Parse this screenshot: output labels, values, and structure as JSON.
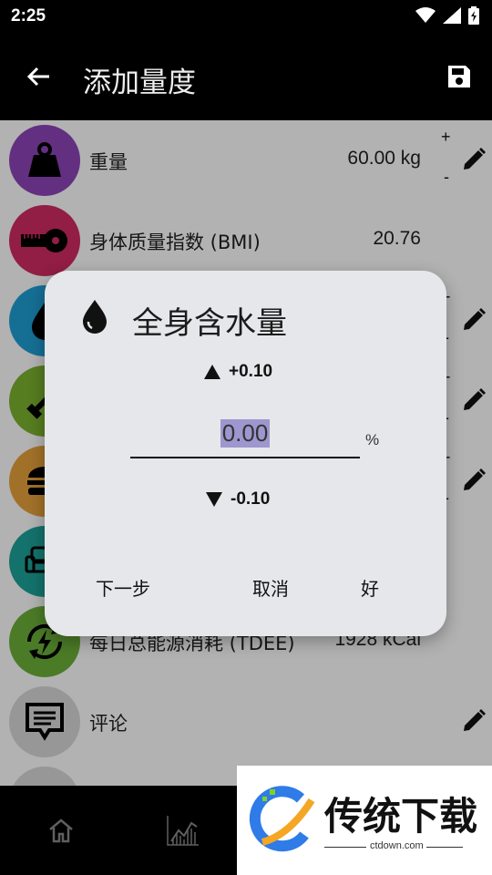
{
  "status": {
    "time": "2:25",
    "icons": [
      "wifi-icon",
      "signal-icon",
      "battery-charging-icon"
    ]
  },
  "appbar": {
    "title": "添加量度",
    "back_icon": "arrow-left-icon",
    "save_icon": "save-icon"
  },
  "rows": [
    {
      "label": "重量",
      "value": "60.00 kg",
      "color": "#8e44b8",
      "icon": "weight-icon",
      "adjust": true,
      "editable": true
    },
    {
      "label": "身体质量指数 (BMI)",
      "value": "20.76",
      "color": "#d12a63",
      "icon": "tape-measure-icon",
      "adjust": false,
      "editable": false
    },
    {
      "label": "",
      "value": "",
      "color": "#1f9fd6",
      "icon": "water-drop-icon",
      "adjust": true,
      "editable": true
    },
    {
      "label": "",
      "value": "",
      "color": "#7cb32f",
      "icon": "dumbbell-icon",
      "adjust": true,
      "editable": true
    },
    {
      "label": "",
      "value": "",
      "color": "#e8a33b",
      "icon": "burger-icon",
      "adjust": true,
      "editable": true
    },
    {
      "label": "",
      "value": "",
      "color": "#1ca49a",
      "icon": "sofa-icon",
      "adjust": false,
      "editable": false
    },
    {
      "label": "每日总能源消耗 (TDEE)",
      "value": "1928 kCal",
      "color": "#6cb038",
      "icon": "energy-cycle-icon",
      "adjust": false,
      "editable": false
    },
    {
      "label": "评论",
      "value": "",
      "color": "#d8d8d8",
      "icon": "comment-icon",
      "adjust": false,
      "editable": true
    }
  ],
  "dialog": {
    "title": "全身含水量",
    "icon": "water-drop-icon",
    "increment": "+0.10",
    "decrement": "-0.10",
    "value": "0.00",
    "unit": "%",
    "next": "下一步",
    "cancel": "取消",
    "ok": "好"
  },
  "bottomnav": {
    "items": [
      "home-icon",
      "chart-icon"
    ]
  },
  "watermark": {
    "text": "传统下载",
    "subtext": "ctdown.com"
  },
  "colors": {
    "bar": "#000000",
    "dialog_bg": "#e6e7ea",
    "selection": "#9d97cf"
  }
}
